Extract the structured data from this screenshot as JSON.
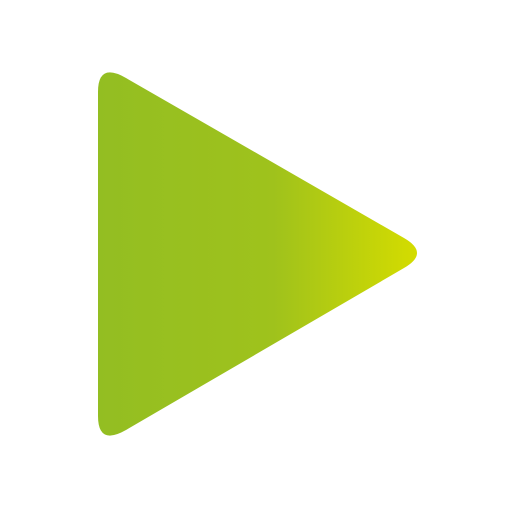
{
  "icon": {
    "name": "play-icon",
    "color_start": "#93be22",
    "color_end": "#d4dc00",
    "background": "#ffffff"
  }
}
